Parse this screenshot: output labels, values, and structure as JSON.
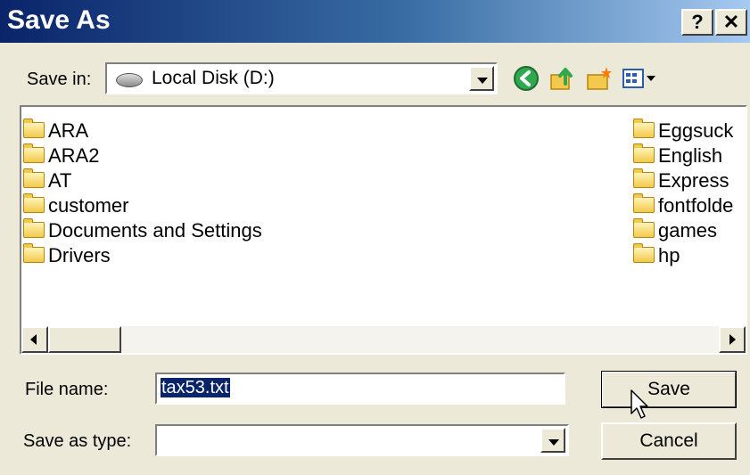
{
  "dialog": {
    "title": "Save As",
    "help_label": "?",
    "close_label": "✕"
  },
  "toolbar": {
    "save_in_label": "Save in:",
    "location": "Local Disk (D:)",
    "icons": [
      "back-icon",
      "up-folder-icon",
      "new-folder-icon",
      "views-menu-icon"
    ]
  },
  "files": {
    "left_column": [
      "ARA",
      "ARA2",
      "AT",
      "customer",
      "Documents and Settings",
      "Drivers"
    ],
    "right_column": [
      "Eggsuck",
      "English",
      "Express",
      "fontfolde",
      "games",
      "hp"
    ]
  },
  "form": {
    "file_name_label": "File name:",
    "file_name_value": "tax53.txt",
    "save_as_type_label": "Save as type:",
    "save_as_type_value": ""
  },
  "buttons": {
    "save_label": "Save",
    "cancel_label": "Cancel"
  },
  "colors": {
    "title_bar": "#0a246a",
    "selection": "#0a246a",
    "folder": "#f2c94c"
  }
}
